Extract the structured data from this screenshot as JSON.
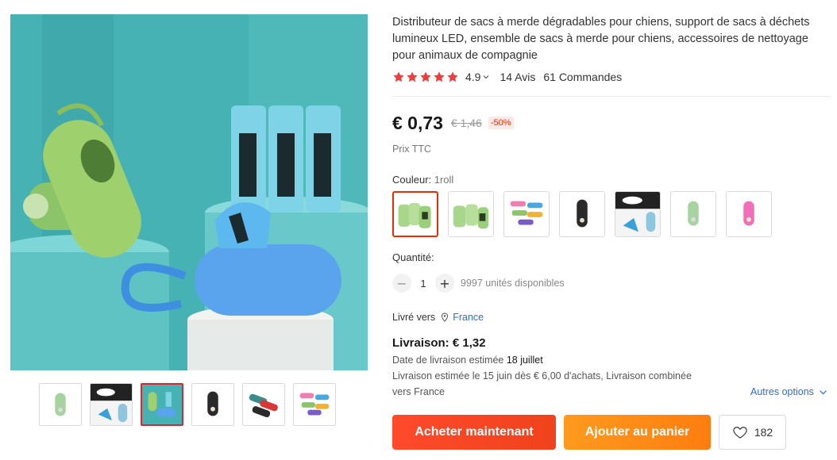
{
  "product": {
    "title": "Distributeur de sacs à merde dégradables pour chiens, support de sacs à déchets lumineux LED, ensemble de sacs à merde pour chiens, accessoires de nettoyage pour animaux de compagnie",
    "rating": "4.9",
    "reviews": "14 Avis",
    "orders": "61 Commandes"
  },
  "price": {
    "current": "€ 0,73",
    "original": "€ 1,46",
    "discount": "-50%",
    "tax_note": "Prix TTC"
  },
  "color": {
    "label": "Couleur: ",
    "value": "1roll",
    "options": [
      "1roll",
      "green-rolls",
      "multicolor-set",
      "black-dispenser",
      "led-dispenser",
      "green-dispenser",
      "pink-dispenser"
    ]
  },
  "quantity": {
    "label": "Quantité:",
    "value": "1",
    "minus": "−",
    "plus": "+",
    "stock": "9997 unités disponibles"
  },
  "shipping": {
    "to_label": "Livré vers",
    "country": "France",
    "title": "Livraison: € 1,32",
    "estimated_prefix": "Date de livraison estimée ",
    "estimated_date": "18 juillet",
    "combined_line1": "Livraison estimée le 15 juin dès € 6,00 d'achats, Livraison combinée",
    "combined_line2": "vers France",
    "more_options": "Autres options"
  },
  "actions": {
    "buy_now": "Acheter maintenant",
    "add_to_cart": "Ajouter au panier",
    "wishlist_count": "182"
  },
  "colors": {
    "accent_red": "#e62e04",
    "buy_button": "#f0421d",
    "cart_button": "#ff7d0f",
    "star": "#f03c3c",
    "link": "#2e6bd6"
  }
}
